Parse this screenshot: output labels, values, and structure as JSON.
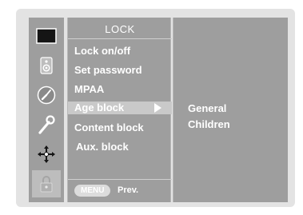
{
  "menu": {
    "title": "LOCK",
    "items": [
      {
        "label": "Lock on/off"
      },
      {
        "label": "Set password"
      },
      {
        "label": "MPAA"
      },
      {
        "label": "Age block"
      },
      {
        "label": "Content block"
      },
      {
        "label": "Aux. block"
      }
    ],
    "selected_index": 3
  },
  "submenu": {
    "items": [
      {
        "label": "General"
      },
      {
        "label": "Children"
      }
    ]
  },
  "footer": {
    "key_label": "MENU",
    "action_label": "Prev."
  },
  "icons": [
    {
      "name": "screen-icon"
    },
    {
      "name": "speaker-icon"
    },
    {
      "name": "clock-icon"
    },
    {
      "name": "wrench-icon"
    },
    {
      "name": "directional-icon"
    },
    {
      "name": "lock-icon"
    }
  ],
  "active_icon_index": 5,
  "colors": {
    "panel_background": "#e3e3e3",
    "menu_background": "#9e9e9e",
    "highlight": "#c9c9c9",
    "text": "#ffffff"
  }
}
